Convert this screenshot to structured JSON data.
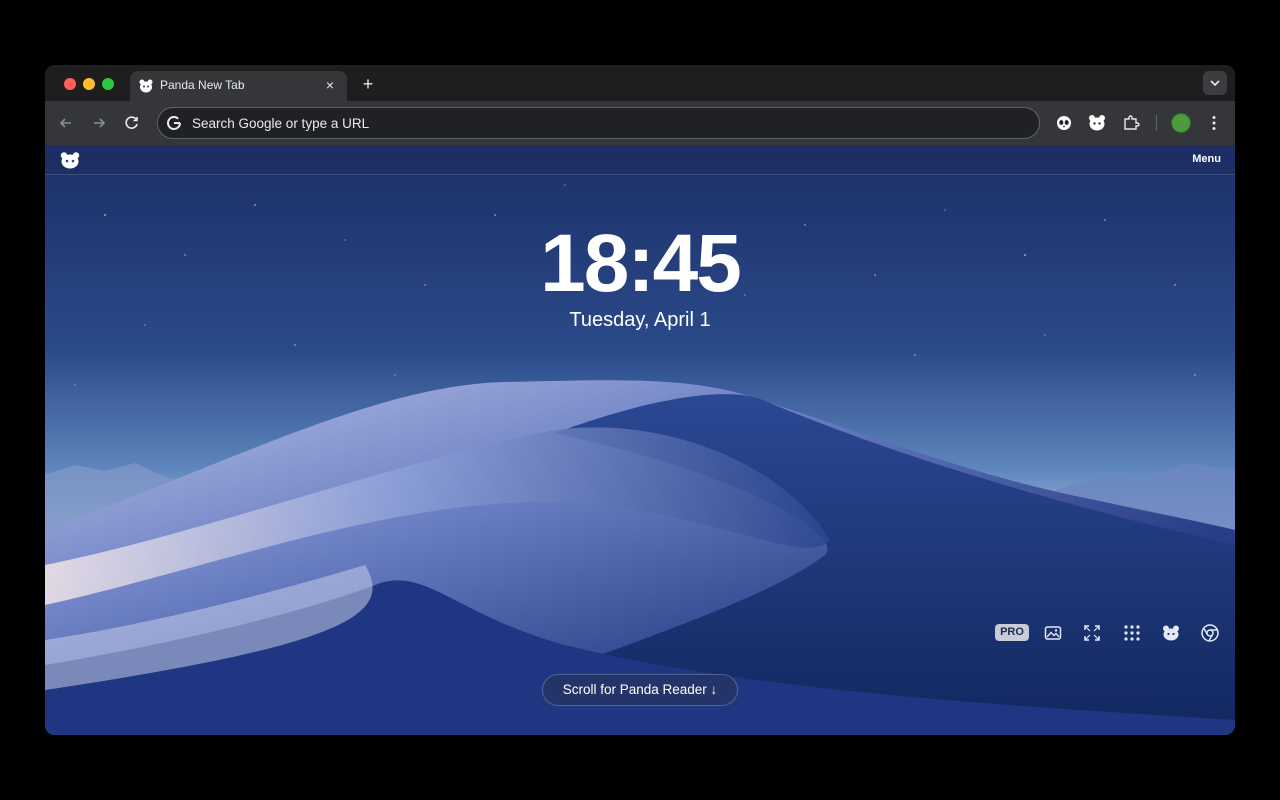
{
  "browser": {
    "tab_title": "Panda New Tab",
    "tab_close": "×",
    "new_tab": "+",
    "omnibox_placeholder": "Search Google or type a URL"
  },
  "newtab": {
    "menu_label": "Menu",
    "time": "18:45",
    "date": "Tuesday, April 1",
    "scroll_label": "Scroll for Panda Reader ↓",
    "pro_badge": "PRO"
  },
  "icons": {
    "back": "back-arrow-icon",
    "forward": "forward-arrow-icon",
    "reload": "reload-icon",
    "google": "google-g-icon",
    "panda_ext": "panda-extension-icon",
    "extensions": "puzzle-icon",
    "more": "kebab-menu-icon",
    "wallpaper": "image-icon",
    "fullscreen": "expand-icon",
    "apps": "grid-icon",
    "chrome": "chrome-icon"
  },
  "colors": {
    "sky_top": "#1b2f66",
    "horizon": "#d9c7d0",
    "dune_dark": "#152a66",
    "accent_profile": "#4e9a3f"
  }
}
